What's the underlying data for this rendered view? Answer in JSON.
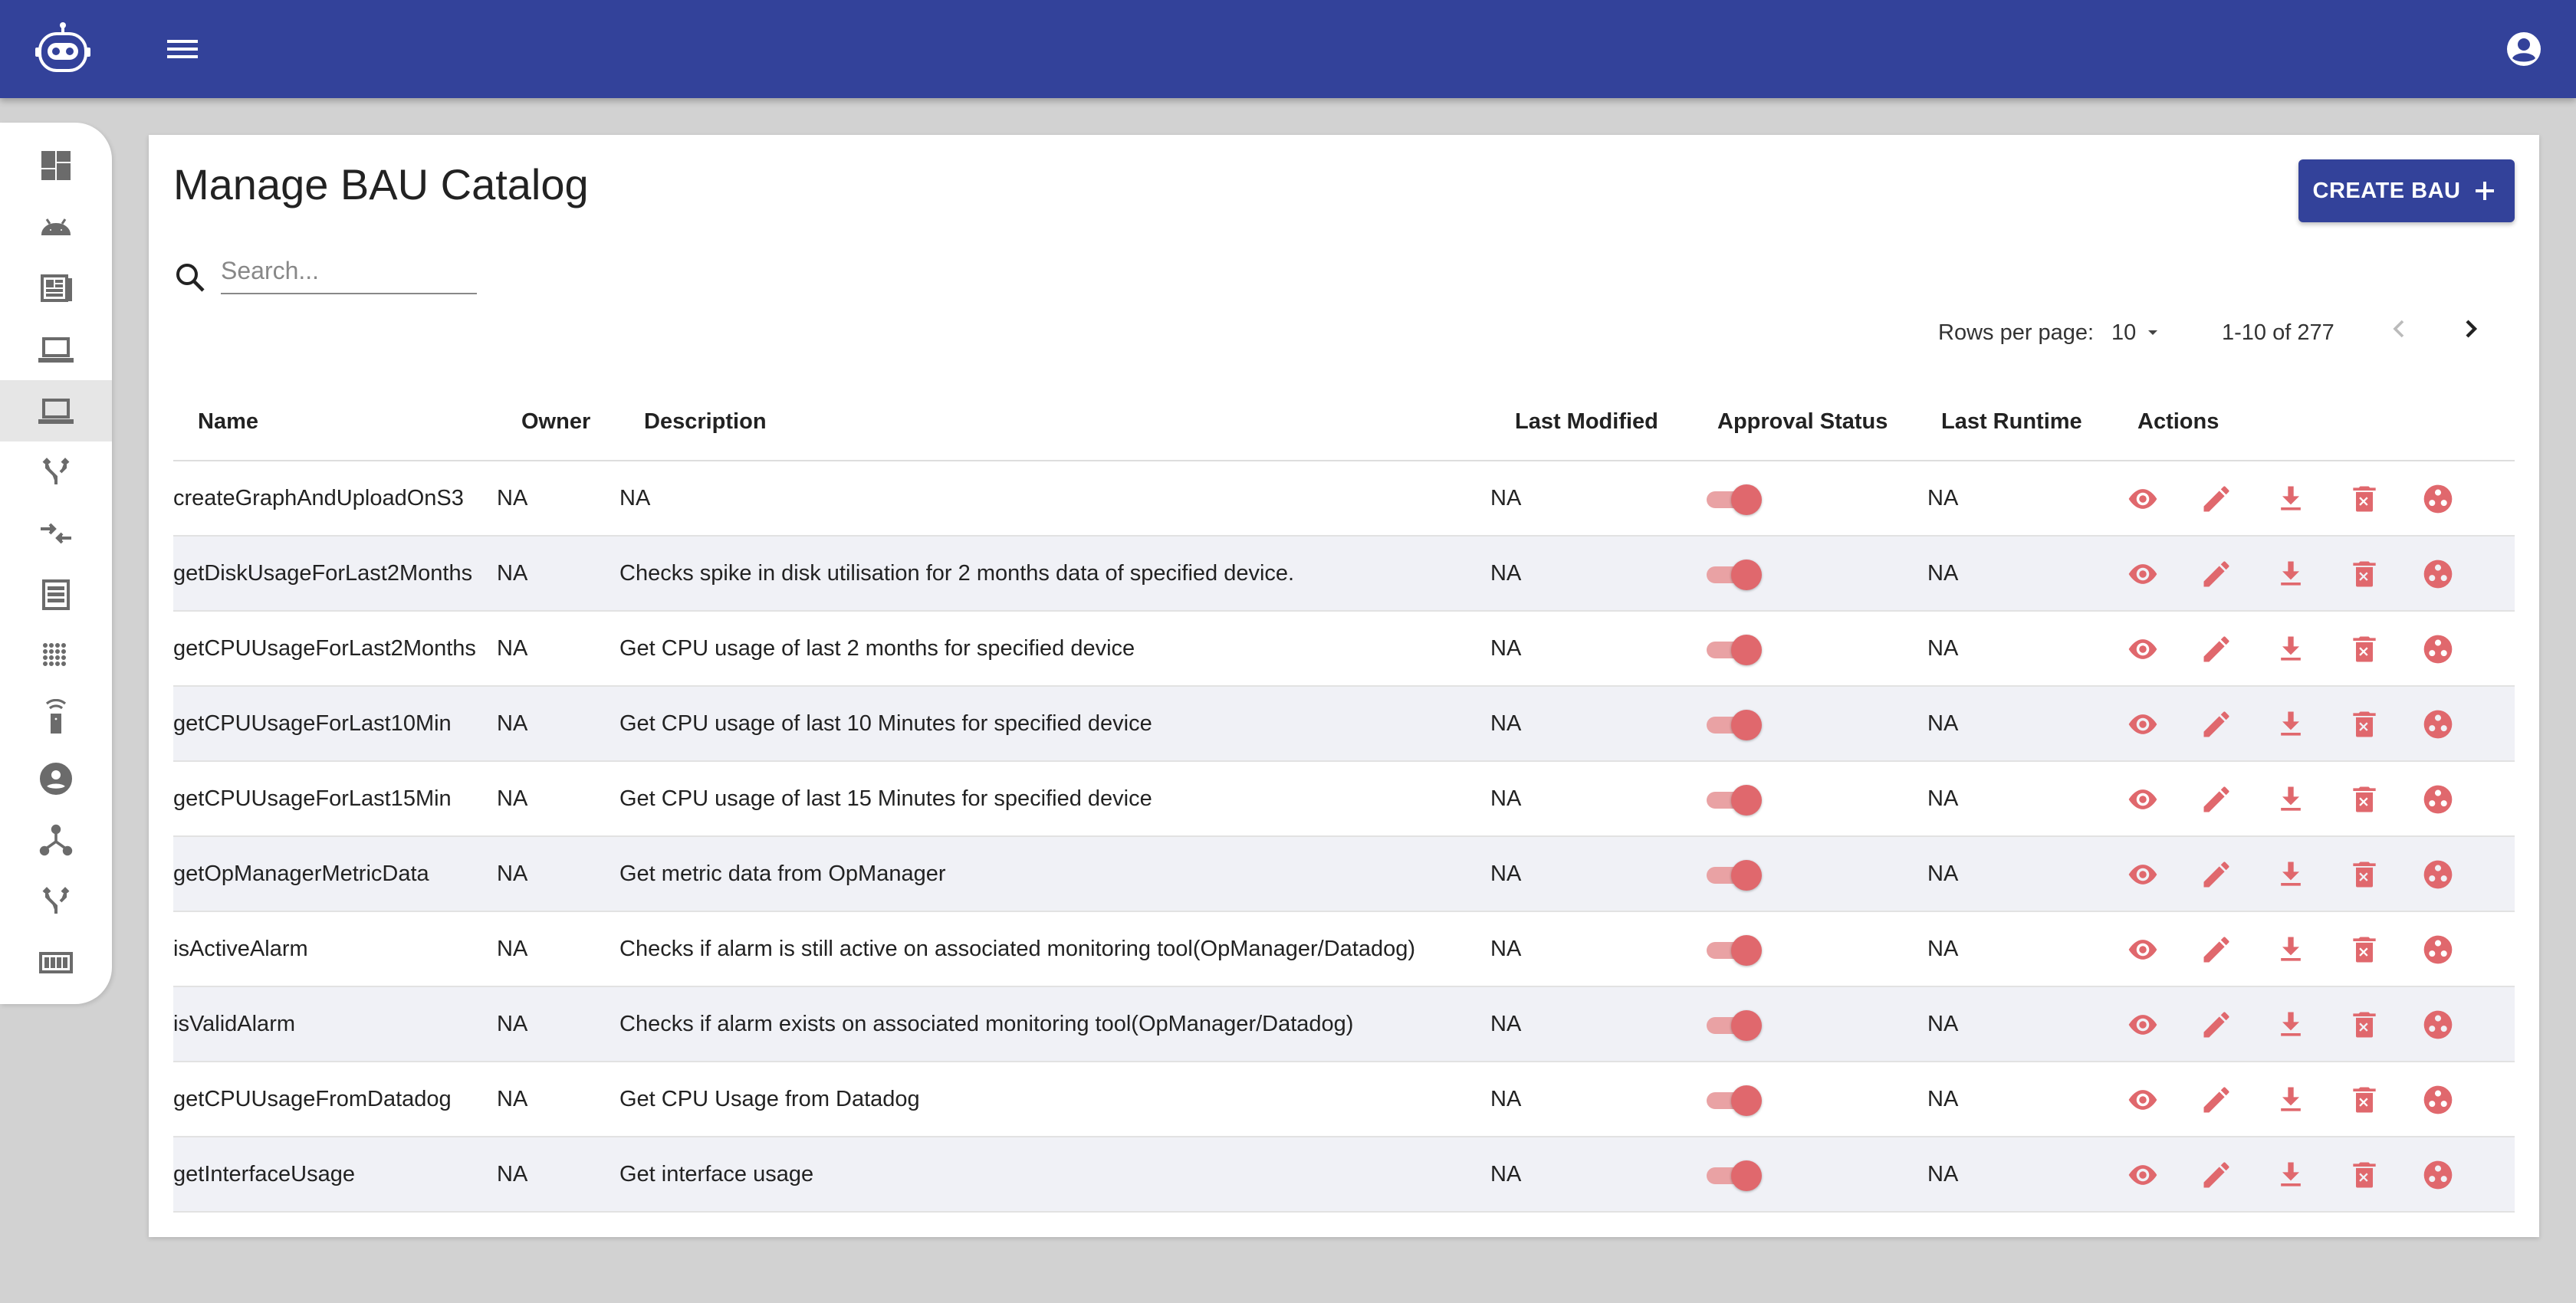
{
  "header": {
    "logo_icon": "robot-icon",
    "menu_icon": "hamburger-icon",
    "account_icon": "account-circle-icon",
    "color": "#33429a"
  },
  "sidebar": {
    "items": [
      {
        "icon": "dashboard-icon"
      },
      {
        "icon": "android-icon"
      },
      {
        "icon": "report-icon"
      },
      {
        "icon": "laptop-icon"
      },
      {
        "icon": "laptop-icon",
        "active": true
      },
      {
        "icon": "fork-icon"
      },
      {
        "icon": "compare-arrows-icon"
      },
      {
        "icon": "list-icon"
      },
      {
        "icon": "dots-grid-icon"
      },
      {
        "icon": "settings-remote-icon"
      },
      {
        "icon": "account-circle-icon"
      },
      {
        "icon": "hub-icon"
      },
      {
        "icon": "fork-icon"
      },
      {
        "icon": "memory-slot-icon"
      }
    ]
  },
  "main": {
    "title": "Manage BAU Catalog",
    "create_label": "CREATE BAU",
    "search": {
      "placeholder": "Search...",
      "value": ""
    },
    "pagination": {
      "rows_label": "Rows per page:",
      "rows_value": "10",
      "range": "1-10 of 277"
    },
    "columns": [
      "Name",
      "Owner",
      "Description",
      "Last Modified",
      "Approval Status",
      "Last Runtime",
      "Actions"
    ],
    "rows": [
      {
        "name": "createGraphAndUploadOnS3",
        "owner": "NA",
        "description": "NA",
        "last_modified": "NA",
        "approved": true,
        "last_runtime": "NA"
      },
      {
        "name": "getDiskUsageForLast2Months",
        "owner": "NA",
        "description": "Checks spike in disk utilisation for 2 months data of specified device.",
        "last_modified": "NA",
        "approved": true,
        "last_runtime": "NA"
      },
      {
        "name": "getCPUUsageForLast2Months",
        "owner": "NA",
        "description": "Get CPU usage of last 2 months for specified device",
        "last_modified": "NA",
        "approved": true,
        "last_runtime": "NA"
      },
      {
        "name": "getCPUUsageForLast10Min",
        "owner": "NA",
        "description": "Get CPU usage of last 10 Minutes for specified device",
        "last_modified": "NA",
        "approved": true,
        "last_runtime": "NA"
      },
      {
        "name": "getCPUUsageForLast15Min",
        "owner": "NA",
        "description": "Get CPU usage of last 15 Minutes for specified device",
        "last_modified": "NA",
        "approved": true,
        "last_runtime": "NA"
      },
      {
        "name": "getOpManagerMetricData",
        "owner": "NA",
        "description": "Get metric data from OpManager",
        "last_modified": "NA",
        "approved": true,
        "last_runtime": "NA"
      },
      {
        "name": "isActiveAlarm",
        "owner": "NA",
        "description": "Checks if alarm is still active on associated monitoring tool(OpManager/Datadog)",
        "last_modified": "NA",
        "approved": true,
        "last_runtime": "NA"
      },
      {
        "name": "isValidAlarm",
        "owner": "NA",
        "description": "Checks if alarm exists on associated monitoring tool(OpManager/Datadog)",
        "last_modified": "NA",
        "approved": true,
        "last_runtime": "NA"
      },
      {
        "name": "getCPUUsageFromDatadog",
        "owner": "NA",
        "description": "Get CPU Usage from Datadog",
        "last_modified": "NA",
        "approved": true,
        "last_runtime": "NA"
      },
      {
        "name": "getInterfaceUsage",
        "owner": "NA",
        "description": "Get interface usage",
        "last_modified": "NA",
        "approved": true,
        "last_runtime": "NA"
      }
    ],
    "row_actions": [
      "view-icon",
      "edit-icon",
      "download-icon",
      "delete-icon",
      "workflow-icon"
    ],
    "accent_color": "#e0686d"
  }
}
